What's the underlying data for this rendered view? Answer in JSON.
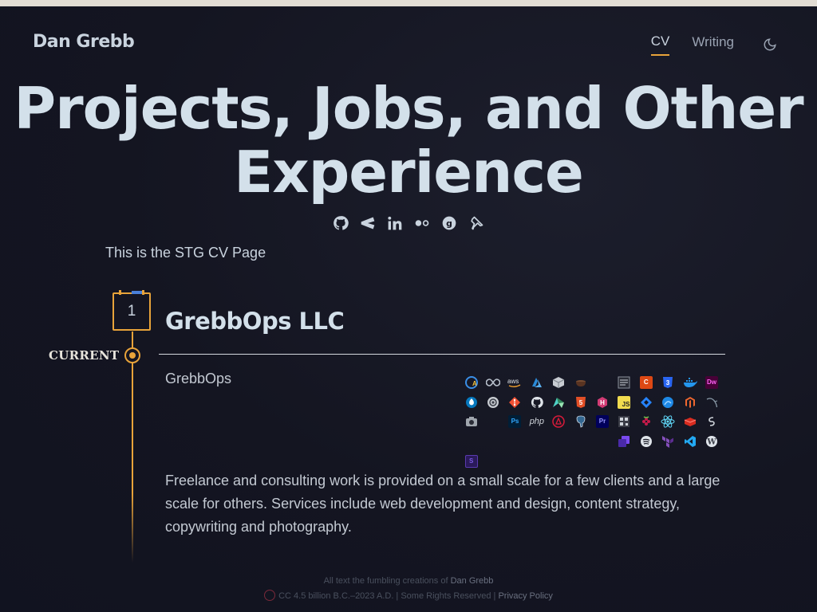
{
  "brand": "Dan Grebb",
  "nav": {
    "items": [
      "CV",
      "Writing"
    ],
    "active": "CV",
    "theme_icon": "moon-icon"
  },
  "hero": {
    "title": "Projects, Jobs, and Other Experience",
    "title_line1": "Projects, Jobs, and Other",
    "title_line2": "Experience"
  },
  "social": [
    "github-icon",
    "codepen-icon",
    "linkedin-icon",
    "flickr-icon",
    "goodreads-icon",
    "pin-icon"
  ],
  "intro": "This is the STG CV Page",
  "timeline": {
    "current_label": "CURRENT",
    "entries": [
      {
        "number": "1",
        "title": "GrebbOps LLC",
        "org": "GrebbOps",
        "description": "Freelance and consulting work is provided on a small scale for a few clients and a large scale for others. Services include web development and design, content strategy, copywriting and photography.",
        "tech_icons": [
          "ansible-icon",
          "infinity-icon",
          "aws-icon",
          "azure-icon",
          "box-icon",
          "coffee-icon",
          "blank",
          "doc-icon",
          "codeigniter-icon",
          "css3-icon",
          "docker-icon",
          "dreamweaver-icon",
          "drupal-icon",
          "circle-icon",
          "git-icon",
          "github-icon",
          "gridsome-icon",
          "html5-icon",
          "hexo-icon",
          "javascript-icon",
          "jira-icon",
          "lighthouse-icon",
          "magento-icon",
          "mysql-icon",
          "camera-icon",
          "blank",
          "photoshop-icon",
          "php-icon",
          "phpstorm-icon",
          "postgresql-icon",
          "premiere-icon",
          "qr-icon",
          "raspberry-pi-icon",
          "react-icon",
          "redis-icon",
          "serverless-icon",
          "blank",
          "blank",
          "blank",
          "blank",
          "blank",
          "blank",
          "blank",
          "stack-icon",
          "spotify-icon",
          "terraform-icon",
          "vscode-icon",
          "wordpress-icon",
          "sass-icon"
        ]
      }
    ]
  },
  "footer": {
    "line1_prefix": "All text the fumbling creations of",
    "line1_link": "Dan Grebb",
    "line2_text": "CC 4.5 billion B.C.–2023 A.D. | Some Rights Reserved |",
    "line2_link": "Privacy Policy"
  },
  "colors": {
    "accent": "#e8a33a",
    "heading": "#d3e0ea",
    "background": "#141521"
  }
}
